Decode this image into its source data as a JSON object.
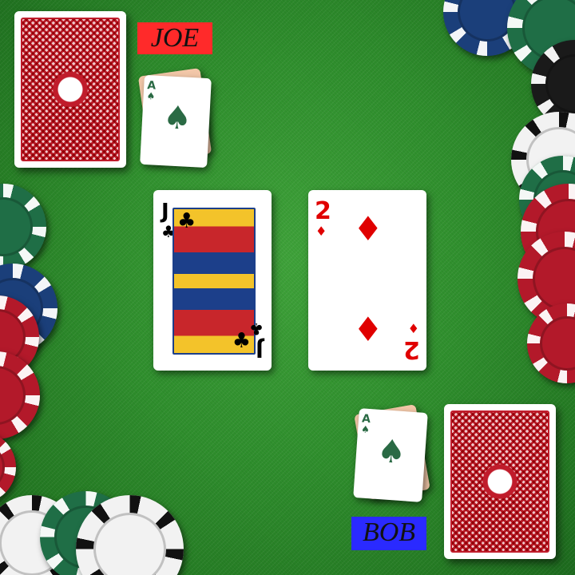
{
  "players": {
    "top": {
      "name": "JOE",
      "tag_color": "#ff2a2a"
    },
    "bottom": {
      "name": "BOB",
      "tag_color": "#2a2aff"
    }
  },
  "cards": {
    "top_hand": {
      "rank": "A",
      "suit": "♠"
    },
    "bottom_hand": {
      "rank": "A",
      "suit": "♠"
    },
    "center_left": {
      "rank": "J",
      "suit": "♣",
      "color": "#000000"
    },
    "center_right": {
      "rank": "2",
      "suit": "♦",
      "color": "#e00000"
    }
  },
  "colors": {
    "felt": "#2f8f2d",
    "card_back": "#c01c2b"
  }
}
